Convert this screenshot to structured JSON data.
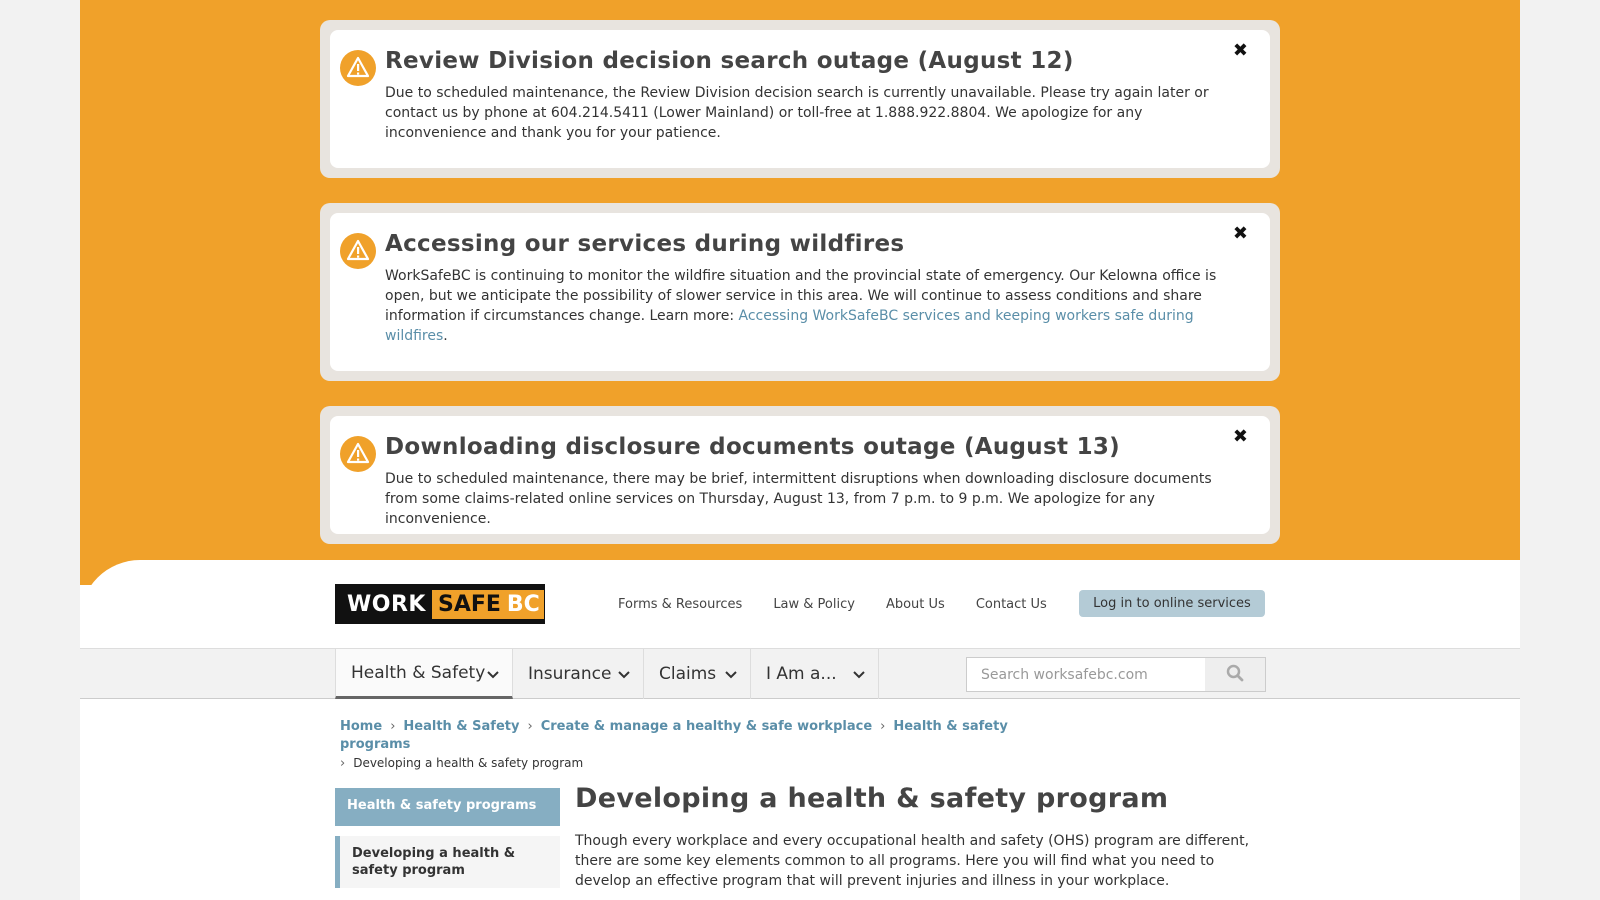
{
  "alerts": [
    {
      "title": "Review Division decision search outage (August 12)",
      "body": "Due to scheduled maintenance, the Review Division decision search is currently unavailable. Please try again later or contact us by phone at 604.214.5411 (Lower Mainland) or toll-free at 1.888.922.8804. We apologize for any inconvenience and thank you for your patience.",
      "close": "✖"
    },
    {
      "title": "Accessing our services during wildfires",
      "body": "WorkSafeBC is continuing to monitor the wildfire situation and the provincial state of emergency. Our Kelowna office is open, but we anticipate the possibility of slower service in this area. We will continue to assess conditions and share information if circumstances change. Learn more: ",
      "link": "Accessing WorkSafeBC services and keeping workers safe during wildfires",
      "after_link": ".",
      "close": "✖"
    },
    {
      "title": "Downloading disclosure documents outage (August 13)",
      "body": "Due to scheduled maintenance, there may be brief, intermittent disruptions when downloading disclosure documents from some claims-related online services on Thursday, August 13, from 7 p.m. to 9 p.m. We apologize for any inconvenience.",
      "close": "✖"
    }
  ],
  "logo": {
    "work": "WORK",
    "safe": "SAFE",
    "bc": "BC"
  },
  "topnav": [
    "Forms & Resources",
    "Law & Policy",
    "About Us",
    "Contact Us"
  ],
  "login_button": "Log in to online services",
  "mainnav": [
    {
      "label": "Health & Safety",
      "icon": "chevron-down-icon"
    },
    {
      "label": "Insurance",
      "icon": "chevron-down-icon"
    },
    {
      "label": "Claims",
      "icon": "chevron-down-icon"
    },
    {
      "label": "I Am a...",
      "icon": "chevron-down-icon"
    }
  ],
  "search": {
    "placeholder": "Search worksafebc.com",
    "icon": "search-icon"
  },
  "breadcrumb": {
    "links": [
      "Home",
      "Health & Safety",
      "Create & manage a healthy & safe workplace",
      "Health & safety programs"
    ],
    "current": "Developing a health & safety program"
  },
  "sidenav": {
    "heading": "Health & safety programs",
    "active_item": "Developing a health & safety program"
  },
  "page_title": "Developing a health & safety program",
  "intro": "Though every workplace and every occupational health and safety (OHS) program are different, there are some key elements common to all programs. Here you will find what you need to develop an effective program that will prevent injuries and illness in your workplace.",
  "colors": {
    "alert_bg": "#f0a12a",
    "link": "#5a8ea8",
    "sidenav_head": "#86aec2",
    "login_btn": "#b4cbd6"
  }
}
